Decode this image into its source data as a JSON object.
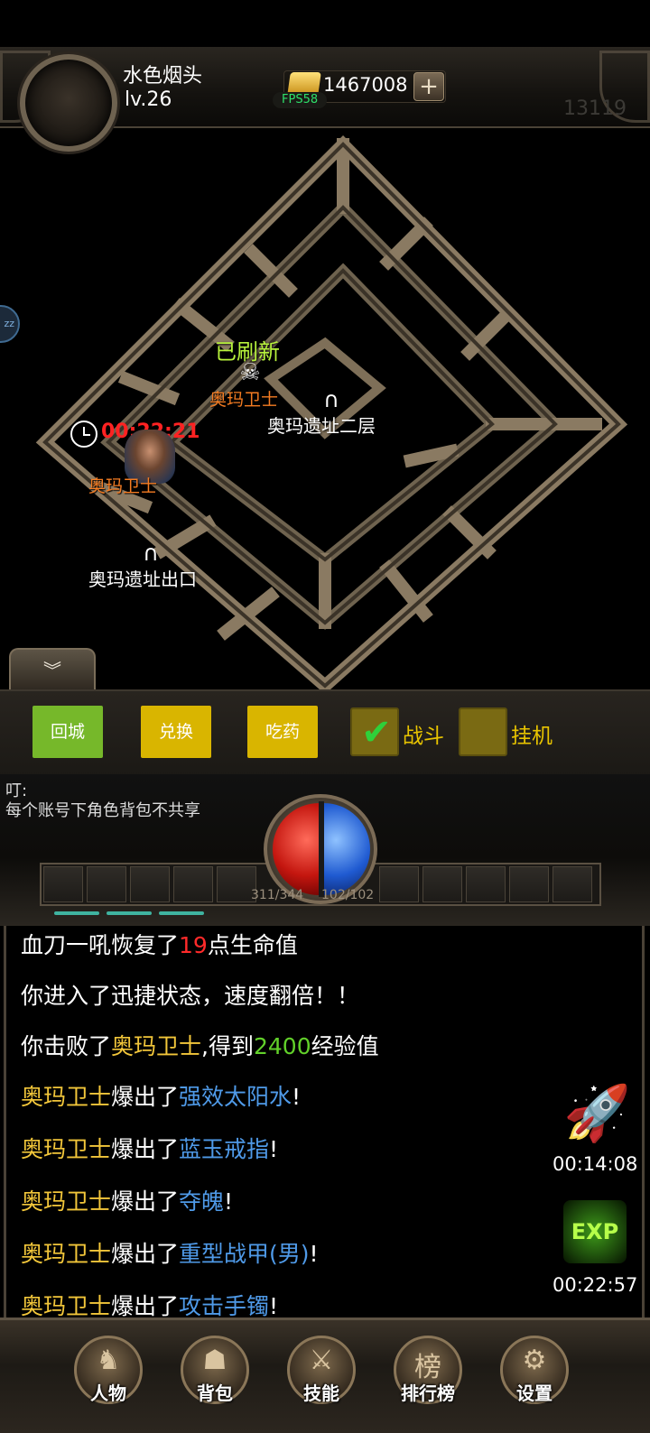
{
  "header": {
    "player_name": "水色烟头",
    "player_level": "lv.26",
    "gold": "1467008",
    "gold_plus": "+",
    "fps": "FPS58",
    "server_no": "13119"
  },
  "map": {
    "refresh_status": "已刷新",
    "monster_1": "奥玛卫士",
    "monster_2": "奥玛卫士",
    "portal_floor2": "奥玛遗址二层",
    "portal_exit": "奥玛遗址出口",
    "respawn_timer": "00:22:21",
    "side_bubble": "zz",
    "collapse_glyph": "︾"
  },
  "actions": {
    "return_city": "回城",
    "exchange": "兑换",
    "take_potion": "吃药",
    "battle": "战斗",
    "battle_checked": true,
    "auto_hunt": "挂机",
    "auto_hunt_checked": false
  },
  "hud": {
    "tip_title": "叮:",
    "tip_text": "每个账号下角色背包不共享",
    "hp": "311/344",
    "mp": "102/102",
    "hp_color": "#c4160f",
    "mp_color": "#1f5ad1"
  },
  "log": [
    [
      {
        "t": "血刀一吼恢复了",
        "c": "white"
      },
      {
        "t": "19",
        "c": "red"
      },
      {
        "t": "点生命值",
        "c": "white"
      }
    ],
    [
      {
        "t": "你进入了迅捷状态，速度翻倍！！",
        "c": "white"
      }
    ],
    [
      {
        "t": "你击败了",
        "c": "white"
      },
      {
        "t": "奥玛卫士",
        "c": "yellow"
      },
      {
        "t": ",得到",
        "c": "white"
      },
      {
        "t": "2400",
        "c": "green"
      },
      {
        "t": "经验值",
        "c": "white"
      }
    ],
    [
      {
        "t": "奥玛卫士",
        "c": "yellow"
      },
      {
        "t": "爆出了",
        "c": "white"
      },
      {
        "t": "强效太阳水",
        "c": "blue"
      },
      {
        "t": "!",
        "c": "white"
      }
    ],
    [
      {
        "t": "奥玛卫士",
        "c": "yellow"
      },
      {
        "t": "爆出了",
        "c": "white"
      },
      {
        "t": "蓝玉戒指",
        "c": "blue"
      },
      {
        "t": "!",
        "c": "white"
      }
    ],
    [
      {
        "t": "奥玛卫士",
        "c": "yellow"
      },
      {
        "t": "爆出了",
        "c": "white"
      },
      {
        "t": "夺魄",
        "c": "blue"
      },
      {
        "t": "!",
        "c": "white"
      }
    ],
    [
      {
        "t": "奥玛卫士",
        "c": "yellow"
      },
      {
        "t": "爆出了",
        "c": "white"
      },
      {
        "t": "重型战甲(男)",
        "c": "blue"
      },
      {
        "t": "!",
        "c": "white"
      }
    ],
    [
      {
        "t": "奥玛卫士",
        "c": "yellow"
      },
      {
        "t": "爆出了",
        "c": "white"
      },
      {
        "t": "攻击手镯",
        "c": "blue"
      },
      {
        "t": "!",
        "c": "white"
      }
    ]
  ],
  "buffs": {
    "speed_timer": "00:14:08",
    "exp_label": "EXP",
    "exp_timer": "00:22:57"
  },
  "nav": [
    {
      "label": "人物",
      "icon": "character-icon",
      "glyph": "♞"
    },
    {
      "label": "背包",
      "icon": "bag-icon",
      "glyph": "☗"
    },
    {
      "label": "技能",
      "icon": "skill-icon",
      "glyph": "⚔"
    },
    {
      "label": "排行榜",
      "icon": "ranking-icon",
      "glyph": "榜"
    },
    {
      "label": "设置",
      "icon": "gear-icon",
      "glyph": "⚙"
    }
  ]
}
